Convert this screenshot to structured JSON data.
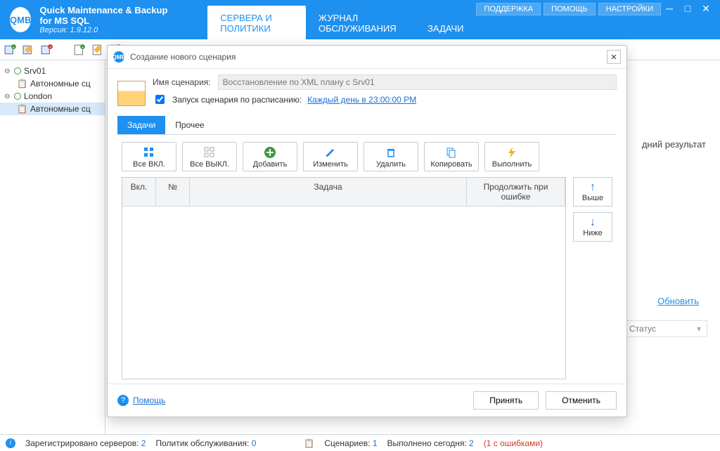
{
  "app": {
    "title": "Quick Maintenance & Backup for MS SQL",
    "version_label": "Версия: 1.9.12.0",
    "logo_text": "QMB"
  },
  "top_links": {
    "support": "ПОДДЕРЖКА",
    "help": "ПОМОЩЬ",
    "settings": "НАСТРОЙКИ"
  },
  "nav": {
    "servers": "СЕРВЕРА И ПОЛИТИКИ",
    "journal": "ЖУРНАЛ ОБСЛУЖИВАНИЯ",
    "tasks": "ЗАДАЧИ"
  },
  "tree": {
    "srv01": "Srv01",
    "srv01_child": "Автономные сц",
    "london": "London",
    "london_child": "Автономные сц"
  },
  "bg": {
    "last_result": "дний результат",
    "refresh": "Обновить",
    "status": "Статус"
  },
  "modal": {
    "title": "Создание нового сценария",
    "name_label": "Имя сценария:",
    "name_value": "Восстановление по XML плану с Srv01",
    "schedule_label": "Запуск сценария по расписанию:",
    "schedule_link": "Каждый день в 23:00:00 PM",
    "tabs": {
      "tasks": "Задачи",
      "other": "Прочее"
    },
    "actions": {
      "all_on": "Все ВКЛ.",
      "all_off": "Все ВЫКЛ.",
      "add": "Добавить",
      "edit": "Изменить",
      "delete": "Удалить",
      "copy": "Копировать",
      "run": "Выполнить"
    },
    "grid": {
      "col_on": "Вкл.",
      "col_no": "№",
      "col_task": "Задача",
      "col_cont": "Продолжить при ошибке"
    },
    "side": {
      "up": "Выше",
      "down": "Ниже"
    },
    "help": "Помощь",
    "accept": "Принять",
    "cancel": "Отменить"
  },
  "status": {
    "servers_label": "Зарегистрировано серверов:",
    "servers_count": "2",
    "policies_label": "Политик обслуживания:",
    "policies_count": "0",
    "scenarios_label": "Сценариев:",
    "scenarios_count": "1",
    "done_label": "Выполнено сегодня:",
    "done_count": "2",
    "errors": "(1 с ошибками)"
  }
}
